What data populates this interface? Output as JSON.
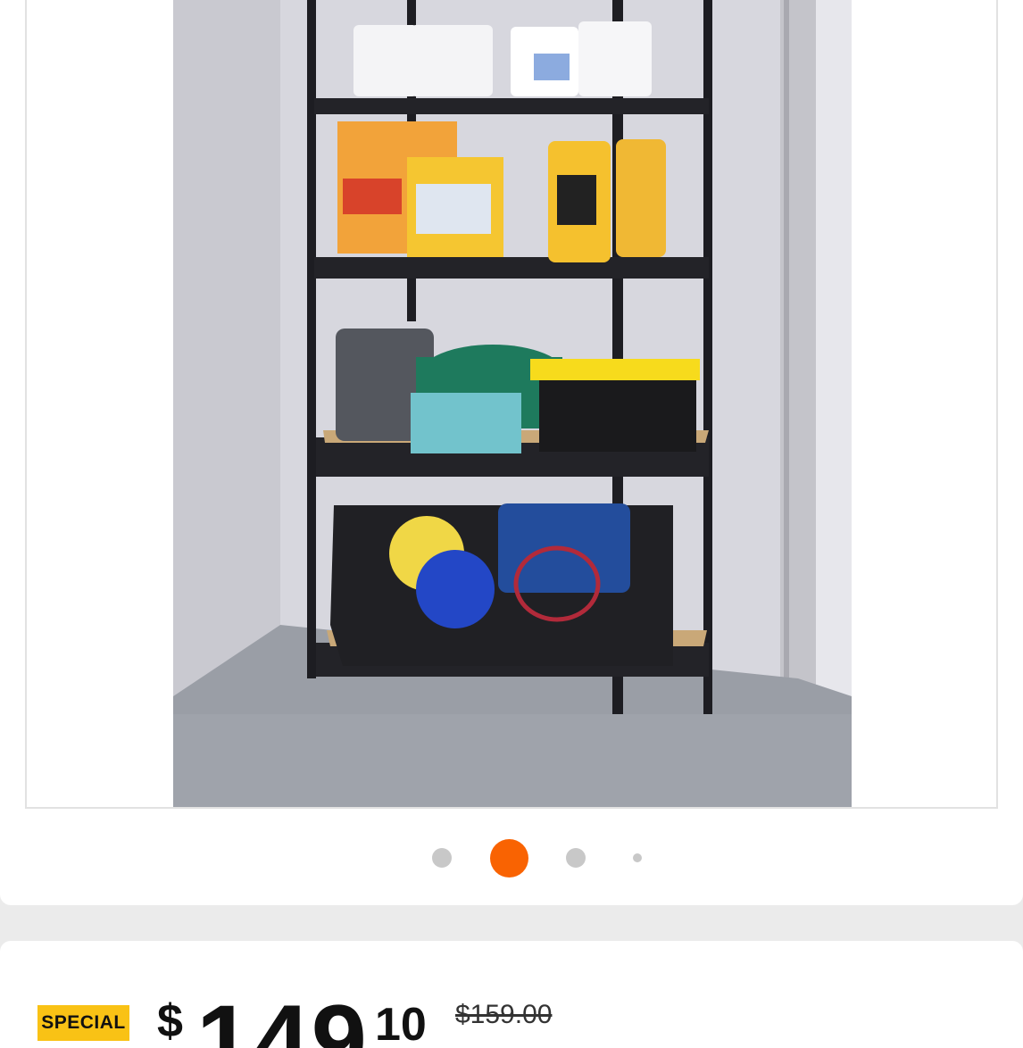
{
  "product": {
    "image_alt": "5-tier black steel garage shelving unit with storage items",
    "carousel": {
      "count": 4,
      "active_index": 1,
      "active_color": "#f96302",
      "inactive_color": "#c8c8c8"
    }
  },
  "pricing": {
    "badge_label": "SPECIAL",
    "badge_color": "#f9c215",
    "currency_symbol": "$",
    "dollars": "149",
    "cents": "10",
    "was_price": "$159.00"
  }
}
